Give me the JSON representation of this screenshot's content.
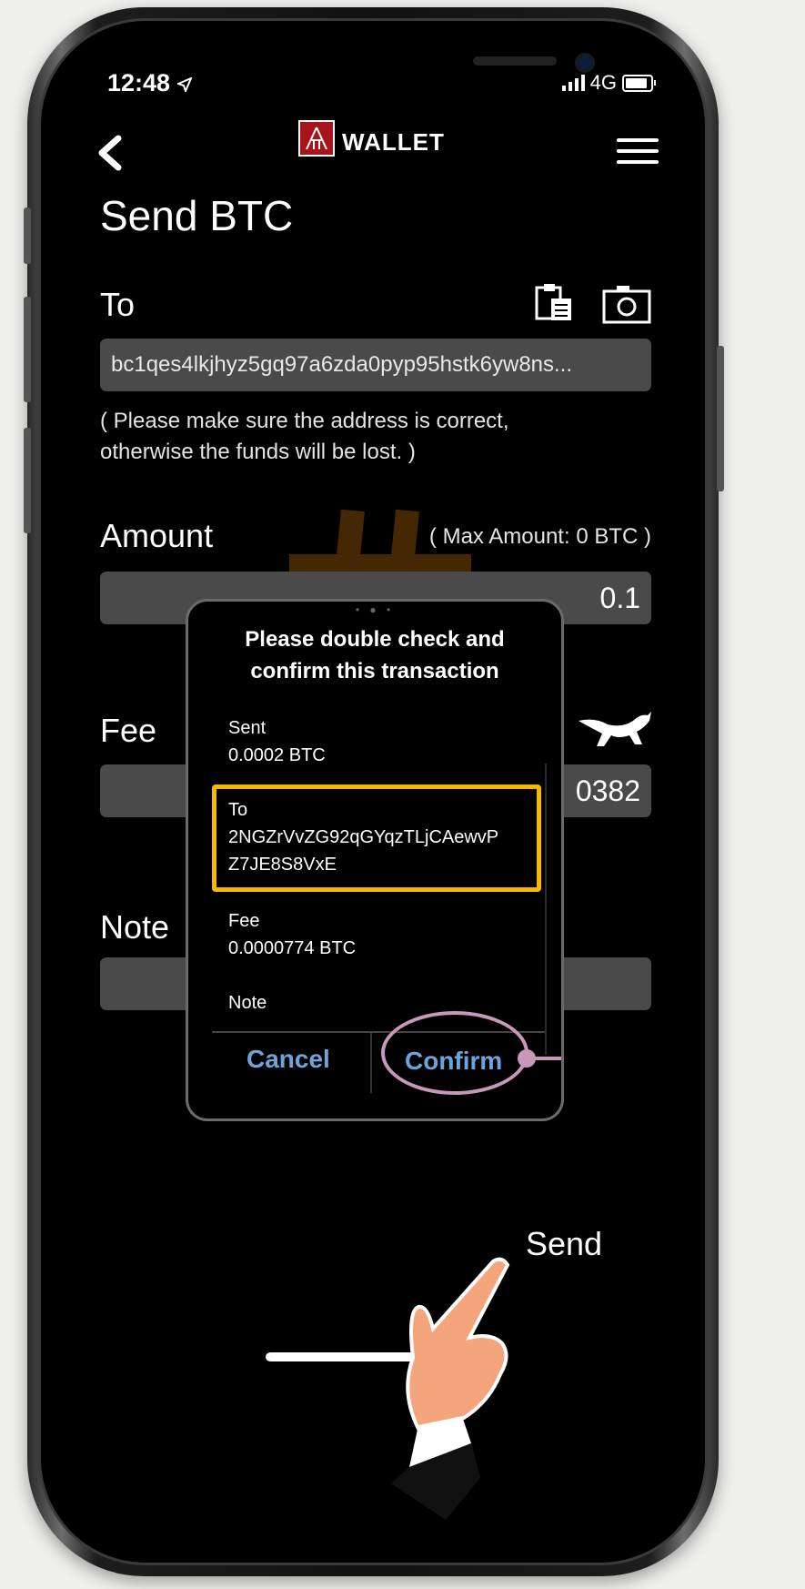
{
  "status_bar": {
    "time": "12:48",
    "network": "4G"
  },
  "header": {
    "logo_text": "WALLET"
  },
  "page": {
    "title": "Send BTC",
    "to_label": "To",
    "address_value": "bc1qes4lkjhyz5gq97a6zda0pyp95hstk6yw8ns...",
    "warning_line1": "( Please make sure the address is correct,",
    "warning_line2": "otherwise the funds will be lost. )",
    "amount_label": "Amount",
    "max_amount": "( Max Amount: 0 BTC )",
    "amount_value": "0.1",
    "fee_label": "Fee",
    "fee_value_partial": "0382",
    "note_label": "Note",
    "send_label": "Send"
  },
  "dialog": {
    "title_line1": "Please double check and",
    "title_line2": "confirm this transaction",
    "sent_label": "Sent",
    "sent_value": "0.0002 BTC",
    "to_label": "To",
    "to_value_line1": "2NGZrVvZG92qGYqzTLjCAewvP",
    "to_value_line2": "Z7JE8S8VxE",
    "fee_label": "Fee",
    "fee_value": "0.0000774 BTC",
    "note_label": "Note",
    "cancel_label": "Cancel",
    "confirm_label": "Confirm"
  },
  "colors": {
    "highlight_box": "#f6b800",
    "confirm_circle": "#c898b8",
    "dialog_button_text": "#6ea4da",
    "logo_red": "#a8141b",
    "field_bg": "#4a4a4a"
  },
  "icons": [
    "back-chevron-icon",
    "menu-icon",
    "paste-clipboard-icon",
    "camera-icon",
    "cheetah-icon",
    "pointing-hand-icon"
  ]
}
